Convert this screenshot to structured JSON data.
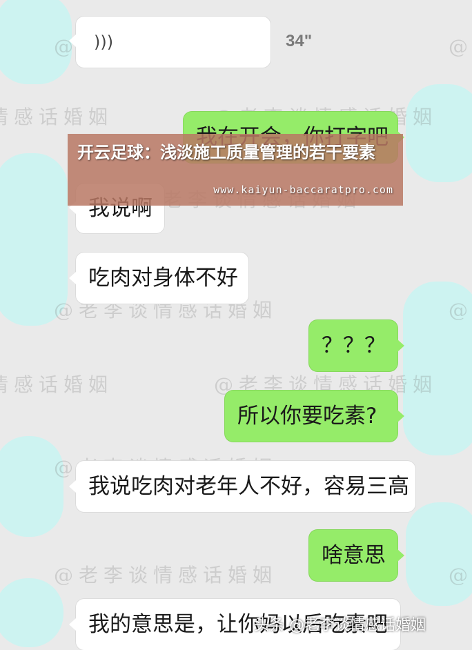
{
  "messages": [
    {
      "id": "voice",
      "side": "left",
      "duration": "34\""
    },
    {
      "id": "m1",
      "side": "right",
      "text": "我在开会，你打字吧"
    },
    {
      "id": "m2",
      "side": "left",
      "text": "我说啊"
    },
    {
      "id": "m3",
      "side": "left",
      "text": "吃肉对身体不好"
    },
    {
      "id": "m4",
      "side": "right",
      "text": "？？？"
    },
    {
      "id": "m5",
      "side": "right",
      "text": "所以你要吃素?"
    },
    {
      "id": "m6",
      "side": "left",
      "text": "我说吃肉对老年人不好，容易三高"
    },
    {
      "id": "m7",
      "side": "right",
      "text": "啥意思"
    },
    {
      "id": "m8",
      "side": "left",
      "text": "我的意思是，让你妈以后吃素吧"
    }
  ],
  "watermark_text": "@老李谈情感话婚姻",
  "overlay": {
    "title": "开云足球：浅淡施工质量管理的若干要素",
    "url": "www.kaiyun-baccaratpro.com"
  },
  "bottom_watermark": "头条 @老李谈情感话婚姻",
  "colors": {
    "background": "#eaeaea",
    "right_bubble": "#95ec69",
    "left_bubble": "#ffffff",
    "avatar_placeholder": "#cdf3f1"
  }
}
